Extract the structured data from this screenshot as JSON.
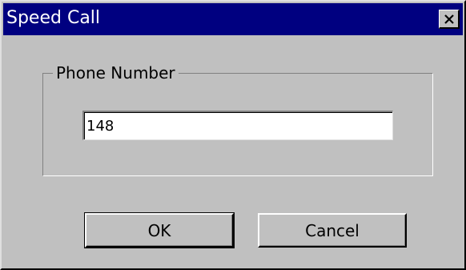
{
  "window": {
    "title": "Speed Call"
  },
  "group": {
    "legend": "Phone Number"
  },
  "phone_field": {
    "value": "148"
  },
  "buttons": {
    "ok_label": "OK",
    "cancel_label": "Cancel"
  },
  "icons": {
    "close": "close-icon"
  },
  "colors": {
    "titlebar": "#000080",
    "face": "#c0c0c0"
  }
}
